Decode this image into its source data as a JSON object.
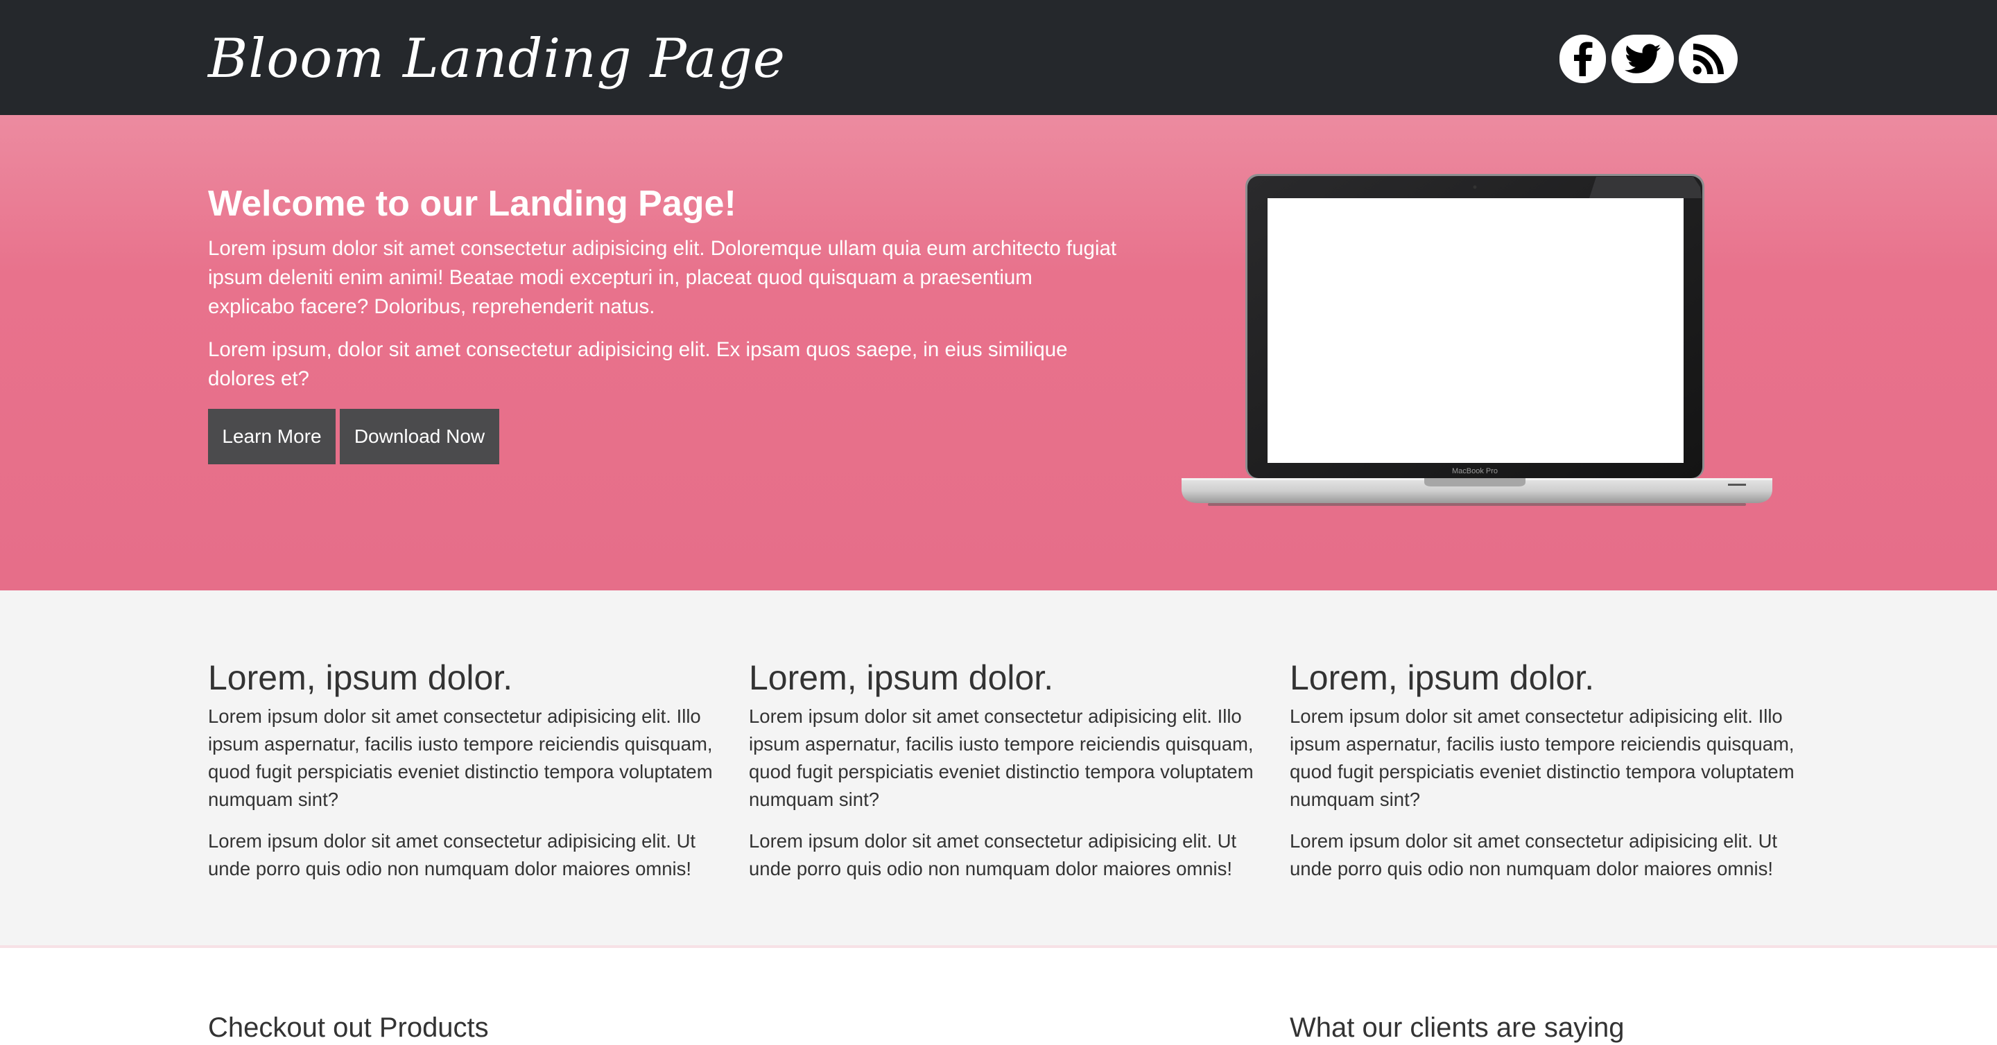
{
  "header": {
    "logo": "Bloom Landing Page",
    "social": [
      {
        "name": "facebook",
        "icon": "facebook-icon"
      },
      {
        "name": "twitter",
        "icon": "twitter-icon"
      },
      {
        "name": "rss",
        "icon": "rss-icon"
      }
    ]
  },
  "hero": {
    "title": "Welcome to our Landing Page!",
    "paragraph1": "Lorem ipsum dolor sit amet consectetur adipisicing elit. Doloremque ullam quia eum architecto fugiat ipsum deleniti enim animi! Beatae modi excepturi in, placeat quod quisquam a praesentium explicabo facere? Doloribus, reprehenderit natus.",
    "paragraph2": "Lorem ipsum, dolor sit amet consectetur adipisicing elit. Ex ipsam quos saepe, in eius similique dolores et?",
    "buttons": {
      "learn_more": "Learn More",
      "download_now": "Download Now"
    },
    "image": {
      "icon": "laptop-image",
      "label": "MacBook Pro"
    }
  },
  "features": [
    {
      "title": "Lorem, ipsum dolor.",
      "p1": "Lorem ipsum dolor sit amet consectetur adipisicing elit. Illo ipsum aspernatur, facilis iusto tempore reiciendis quisquam, quod fugit perspiciatis eveniet distinctio tempora voluptatem numquam sint?",
      "p2": "Lorem ipsum dolor sit amet consectetur adipisicing elit. Ut unde porro quis odio non numquam dolor maiores omnis!"
    },
    {
      "title": "Lorem, ipsum dolor.",
      "p1": "Lorem ipsum dolor sit amet consectetur adipisicing elit. Illo ipsum aspernatur, facilis iusto tempore reiciendis quisquam, quod fugit perspiciatis eveniet distinctio tempora voluptatem numquam sint?",
      "p2": "Lorem ipsum dolor sit amet consectetur adipisicing elit. Ut unde porro quis odio non numquam dolor maiores omnis!"
    },
    {
      "title": "Lorem, ipsum dolor.",
      "p1": "Lorem ipsum dolor sit amet consectetur adipisicing elit. Illo ipsum aspernatur, facilis iusto tempore reiciendis quisquam, quod fugit perspiciatis eveniet distinctio tempora voluptatem numquam sint?",
      "p2": "Lorem ipsum dolor sit amet consectetur adipisicing elit. Ut unde porro quis odio non numquam dolor maiores omnis!"
    }
  ],
  "bottom": {
    "products_title": "Checkout out Products",
    "clients_title": "What our clients are saying"
  },
  "colors": {
    "header_bg": "#25282c",
    "hero_pink": "#e8728c",
    "button_bg": "#4b4b4d",
    "features_bg": "#f4f4f4"
  }
}
